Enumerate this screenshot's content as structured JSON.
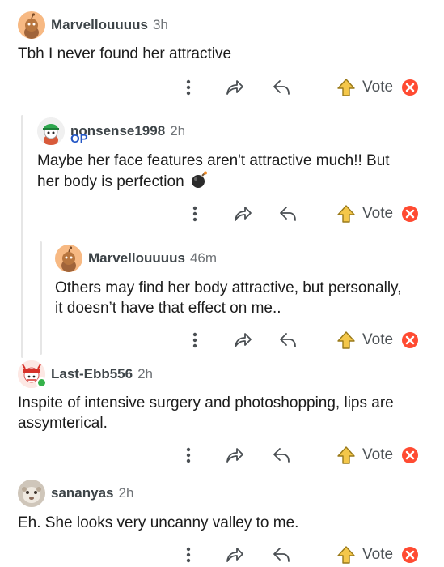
{
  "comments": [
    {
      "username": "Marvellouuuus",
      "time": "3h",
      "text": "Tbh I never found her attractive",
      "vote_label": "Vote",
      "avatar": "snoo-orange-avatar"
    },
    {
      "username": "nonsense1998",
      "time": "2h",
      "badge": "OP",
      "text_line1": "Maybe her face features aren't attractive much!!  But",
      "text_line2": "her body is perfection",
      "emoji": "bomb-emoji",
      "vote_label": "Vote",
      "avatar": "snoo-green-cap-avatar"
    },
    {
      "username": "Marvellouuuus",
      "time": "46m",
      "text_line1": "Others may find her body attractive, but personally,",
      "text_line2": "it doesn’t have that effect on me..",
      "vote_label": "Vote",
      "avatar": "snoo-orange-avatar"
    },
    {
      "username": "Last-Ebb556",
      "time": "2h",
      "text_line1": "Inspite of intensive surgery and photoshopping, lips are",
      "text_line2": "assymterical.",
      "vote_label": "Vote",
      "avatar": "snoo-red-headband-avatar",
      "online": true
    },
    {
      "username": "sananyas",
      "time": "2h",
      "text": "Eh. She looks very uncanny valley to me.",
      "vote_label": "Vote",
      "avatar": "photo-avatar"
    }
  ],
  "colors": {
    "upvote_fill": "#f4c74a",
    "downvote_fill": "#ff4b32",
    "op_badge": "#2457c5",
    "online": "#36b24a",
    "thread_line": "#e6e6e6"
  }
}
